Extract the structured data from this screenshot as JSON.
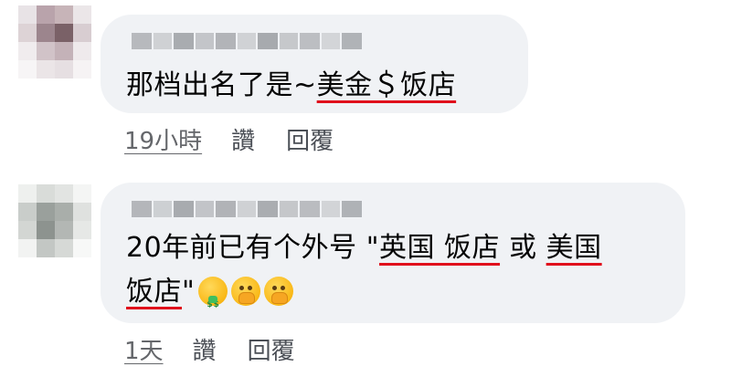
{
  "comments": [
    {
      "text_before": "那档出名了是~",
      "text_underlined": "美金＄饭店",
      "time": "19小時",
      "like_label": "讚",
      "reply_label": "回覆"
    },
    {
      "line1_before": "20年前已有个外号 \"",
      "line1_ul1": "英国 饭店",
      "line1_mid": " 或 ",
      "line1_ul2": "美国",
      "line2_ul": "饭店",
      "line2_after": "\"",
      "emojis": [
        "money-mouth-face-icon",
        "face-with-hand-over-mouth-icon",
        "face-with-hand-over-mouth-icon"
      ],
      "time": "1天",
      "like_label": "讚",
      "reply_label": "回覆"
    }
  ],
  "colors": {
    "bubble": "#f0f2f5",
    "underline": "#e0101c",
    "meta": "#65676b"
  }
}
